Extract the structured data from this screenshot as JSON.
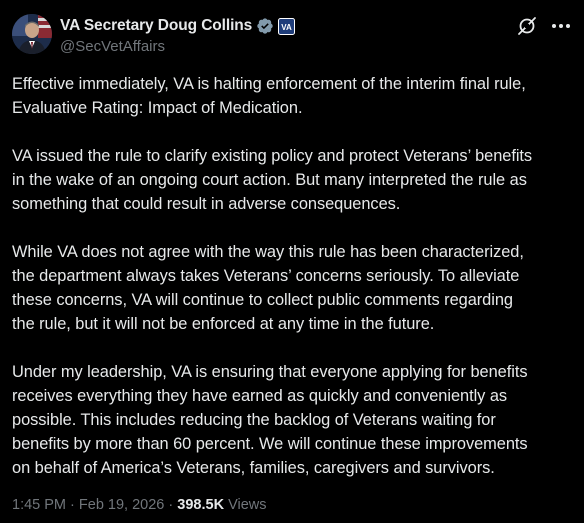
{
  "author": {
    "display_name": "VA Secretary Doug Collins",
    "handle": "@SecVetAffairs",
    "avatar_icon": "portrait-avatar",
    "verified_icon": "verified-badge-icon",
    "org_badge_icon": "va-affiliate-badge-icon",
    "org_badge_text": "VA"
  },
  "actions": {
    "grok_icon": "grok-icon",
    "more_icon": "more-options-icon"
  },
  "post": {
    "paragraphs": [
      "Effective immediately, VA is halting enforcement of the interim final rule,\nEvaluative Rating: Impact of Medication.",
      "VA issued the rule to clarify existing policy and protect Veterans’ benefits\nin the wake of an ongoing court action. But many interpreted the rule as\nsomething that could result in adverse consequences.",
      "While VA does not agree with the way this rule has been characterized,\nthe department always takes Veterans’ concerns seriously. To alleviate\nthese concerns, VA will continue to collect public comments regarding\nthe rule, but it will not be enforced at any time in the future.",
      "Under my leadership, VA is ensuring that everyone applying for benefits\nreceives everything they have earned as quickly and conveniently as\npossible. This includes reducing the backlog of Veterans waiting for\nbenefits by more than 60 percent. We will continue these improvements\non behalf of America’s Veterans, families, caregivers and survivors."
    ]
  },
  "meta": {
    "time": "1:45 PM",
    "separator": "·",
    "date": "Feb 19, 2026",
    "views_count": "398.5K",
    "views_label": "Views"
  },
  "colors": {
    "background": "#000000",
    "text": "#e7e9ea",
    "secondary": "#71767b",
    "verified": "#829aab"
  }
}
